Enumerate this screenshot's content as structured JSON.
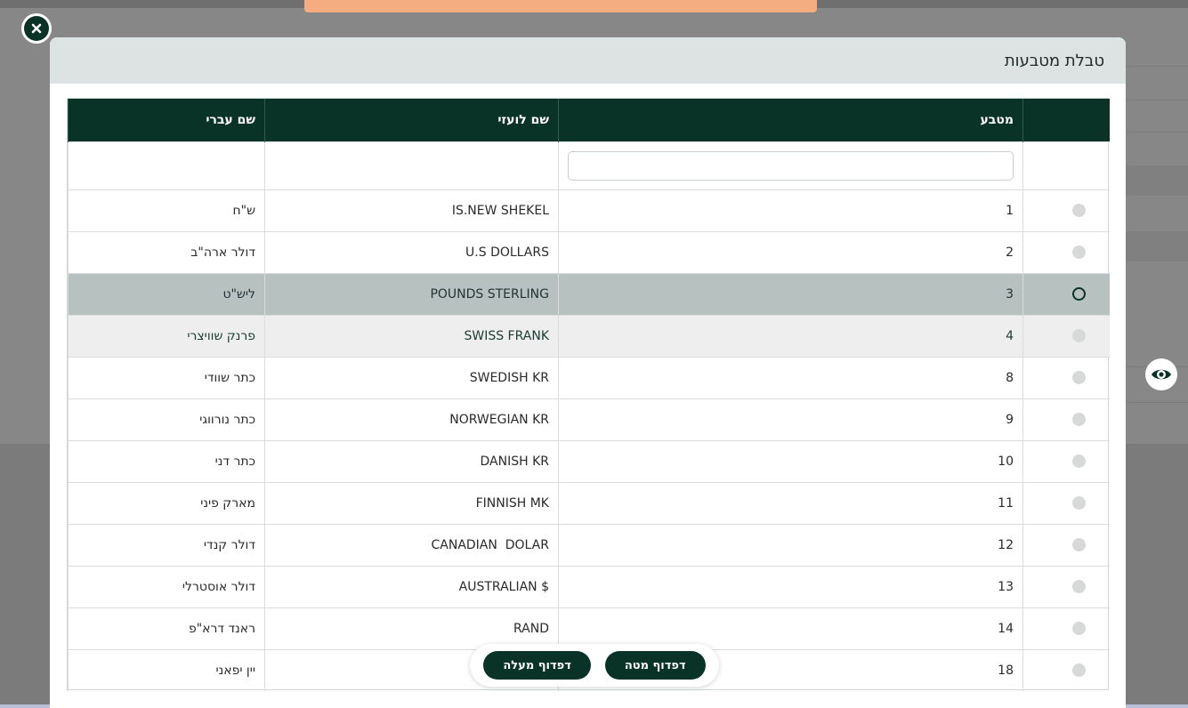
{
  "modal": {
    "title": "טבלת מטבעות"
  },
  "table": {
    "headers": [
      "",
      "מטבע",
      "שם לועזי",
      "שם עברי"
    ],
    "rows": [
      {
        "code": "1",
        "foreign": "IS.NEW SHEKEL",
        "hebrew": "ש\"ח"
      },
      {
        "code": "2",
        "foreign": "U.S DOLLARS",
        "hebrew": "דולר ארה\"ב"
      },
      {
        "code": "3",
        "foreign": "POUNDS STERLING",
        "hebrew": "ליש\"ט"
      },
      {
        "code": "4",
        "foreign": "SWISS FRANK",
        "hebrew": "פרנק שוויצרי"
      },
      {
        "code": "8",
        "foreign": "SWEDISH KR",
        "hebrew": "כתר שוודי"
      },
      {
        "code": "9",
        "foreign": "NORWEGIAN KR",
        "hebrew": "כתר נורווגי"
      },
      {
        "code": "10",
        "foreign": "DANISH KR",
        "hebrew": "כתר דני"
      },
      {
        "code": "11",
        "foreign": "FINNISH MK",
        "hebrew": "מארק פיני"
      },
      {
        "code": "12",
        "foreign": "CANADIAN  DOLAR",
        "hebrew": "דולר קנדי"
      },
      {
        "code": "13",
        "foreign": "$ AUSTRALIAN",
        "hebrew": "דולר אוסטרלי"
      },
      {
        "code": "14",
        "foreign": "RAND",
        "hebrew": "ראנד דרא\"פ"
      },
      {
        "code": "18",
        "foreign": "",
        "hebrew": "יין יפאני"
      }
    ]
  },
  "pager": {
    "down_label": "דפדוף מטה",
    "up_label": "דפדוף מעלה"
  },
  "colors": {
    "primary": "#0a3328",
    "selected_row": "#b7c1bf",
    "header_bg": "#dde2e2",
    "toast": "#f4ad80"
  },
  "icons": {
    "close": "close-circle-icon",
    "eye": "eye-icon",
    "radio": "radio-icon"
  }
}
